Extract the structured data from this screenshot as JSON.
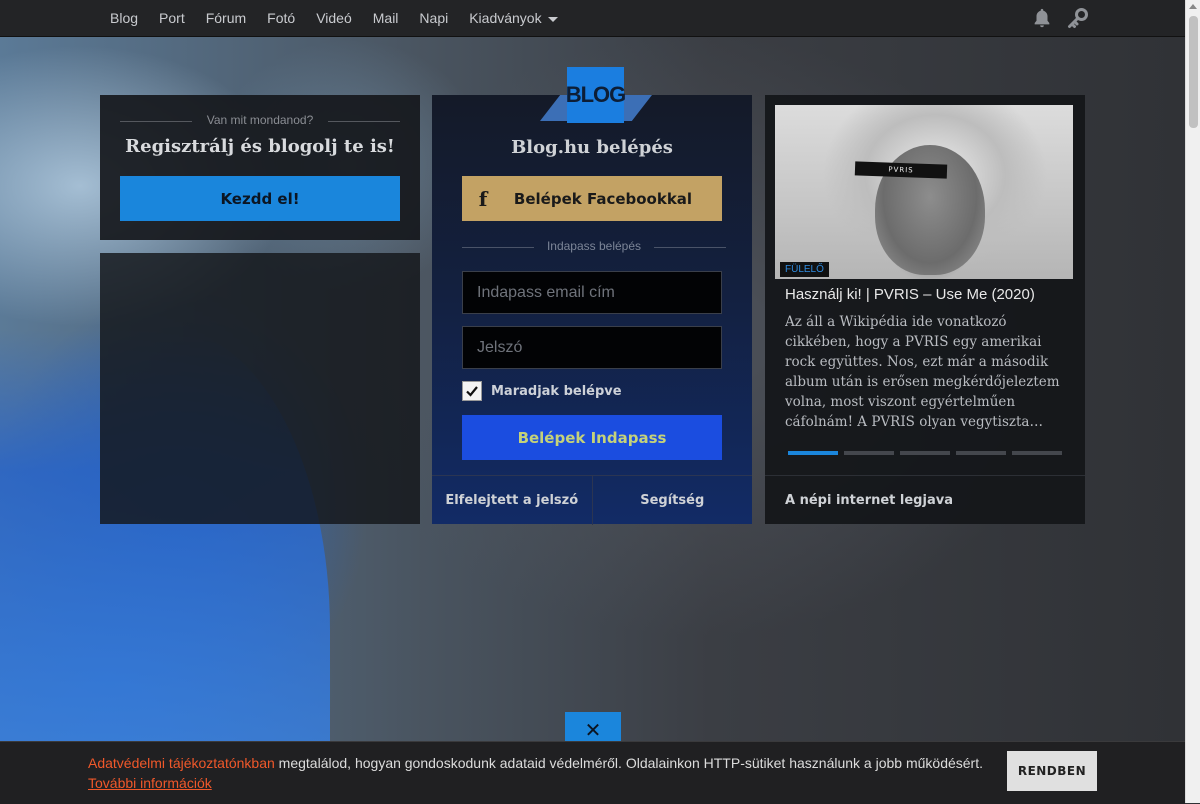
{
  "topnav": {
    "links": [
      "Blog",
      "Port",
      "Fórum",
      "Fotó",
      "Videó",
      "Mail",
      "Napi"
    ],
    "dropdown_label": "Kiadványok",
    "icons": {
      "notifications": "bell-icon",
      "login": "key-icon"
    }
  },
  "register": {
    "kicker": "Van mit mondanod?",
    "headline": "Regisztrálj és blogolj te is!",
    "button": "Kezdd el!"
  },
  "login": {
    "logo": "BLOG",
    "title": "Blog.hu belépés",
    "facebook_button": "Belépek Facebookkal",
    "facebook_icon": "f",
    "indapass_divider": "Indapass belépés",
    "email_placeholder": "Indapass email cím",
    "password_placeholder": "Jelszó",
    "remember_label": "Maradjak belépve",
    "remember_checked": true,
    "submit_button": "Belépek Indapass",
    "forgot_link": "Elfelejtett a jelszó",
    "help_link": "Segítség"
  },
  "news": {
    "tag": "FÜLELŐ",
    "headline": "Használj ki! | PVRIS – Use Me (2020)",
    "image_caption": "PVRIS",
    "excerpt": "Az áll a Wikipédia ide vonatkozó cikkében, hogy a PVRIS egy amerikai rock együttes. Nos, ezt már a második album után is erősen megkérdőjeleztem volna, most viszont egyértelműen cáfolnám! A PVRIS olyan vegytiszta…",
    "slides": 5,
    "active_slide": 1,
    "footer": "A népi internet legjava"
  },
  "close_tab_icon": "✕",
  "cookie": {
    "link_text": "Adatvédelmi tájékoztatónkban",
    "text": " megtalálod, hogyan gondoskodunk adataid védelméről. Oldalainkon HTTP-sütiket használunk a jobb működésért.",
    "more_link": "További információk",
    "button": "RENDBEN"
  },
  "colors": {
    "accent_blue": "#1a86dc",
    "facebook_gold": "#c3a264",
    "indapass_blue": "#1b4de0",
    "cookie_link": "#f0582a"
  }
}
